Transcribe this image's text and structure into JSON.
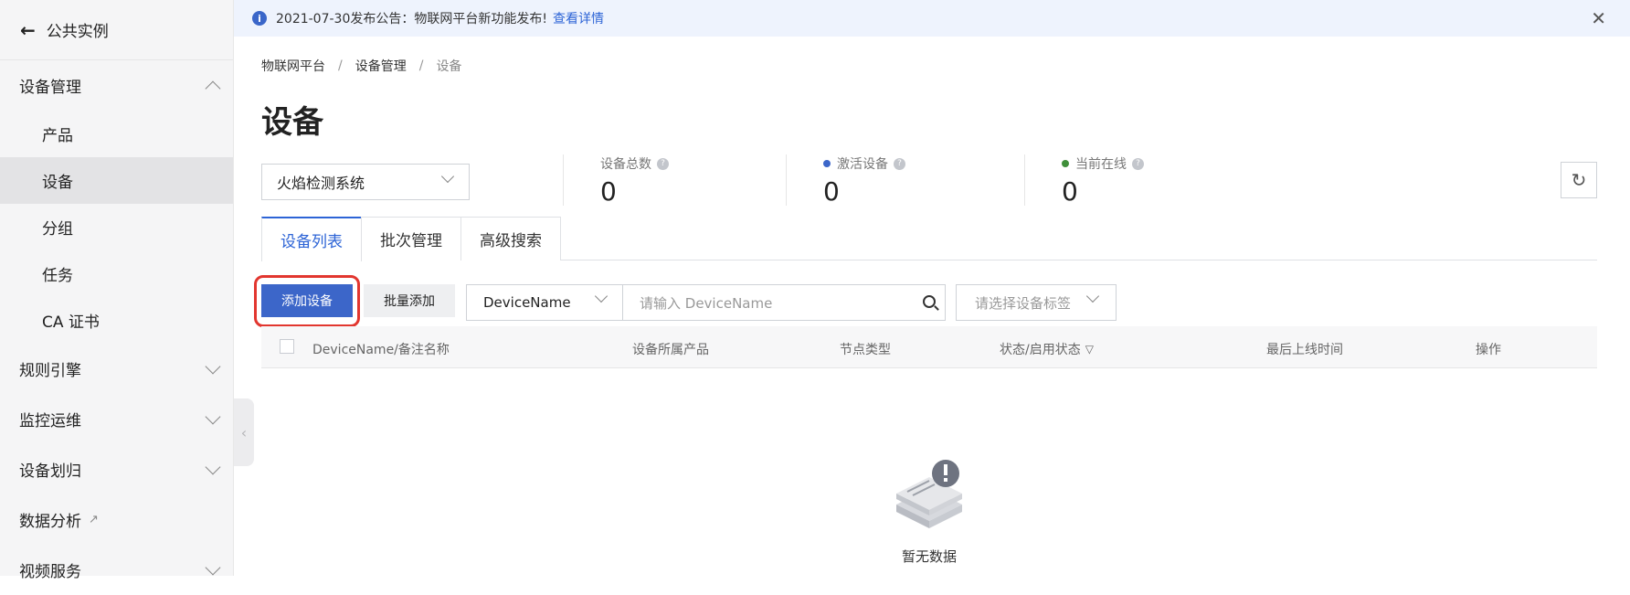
{
  "sidebar": {
    "back_label": "公共实例",
    "groups": [
      {
        "label": "设备管理",
        "expanded": true
      },
      {
        "label": "规则引擎"
      },
      {
        "label": "监控运维"
      },
      {
        "label": "设备划归"
      },
      {
        "label": "数据分析"
      },
      {
        "label": "视频服务"
      }
    ],
    "sub_items": [
      "产品",
      "设备",
      "分组",
      "任务",
      "CA 证书"
    ]
  },
  "notice": {
    "text": "2021-07-30发布公告：物联网平台新功能发布!",
    "link": "查看详情"
  },
  "breadcrumb": [
    "物联网平台",
    "设备管理",
    "设备"
  ],
  "page_title": "设备",
  "product_select": "火焰检测系统",
  "stats": [
    {
      "label": "设备总数",
      "value": "0"
    },
    {
      "label": "激活设备",
      "value": "0",
      "dot_color": "#3c66c9"
    },
    {
      "label": "当前在线",
      "value": "0",
      "dot_color": "#3f8f3a"
    }
  ],
  "tabs": [
    "设备列表",
    "批次管理",
    "高级搜索"
  ],
  "toolbar": {
    "add_device": "添加设备",
    "batch_add": "批量添加",
    "field_select": "DeviceName",
    "search_placeholder": "请输入 DeviceName",
    "tag_placeholder": "请选择设备标签"
  },
  "table": {
    "columns": [
      "DeviceName/备注名称",
      "设备所属产品",
      "节点类型",
      "状态/启用状态",
      "最后上线时间",
      "操作"
    ]
  },
  "empty_text": "暂无数据",
  "colors": {
    "accent": "#2d64d6",
    "primary_button": "#3c66c9",
    "highlight": "#e2362f"
  }
}
